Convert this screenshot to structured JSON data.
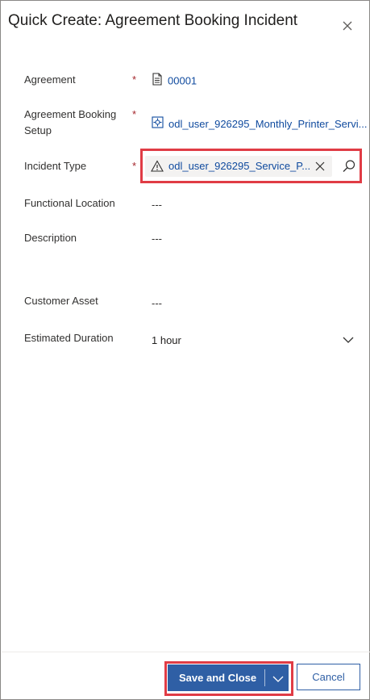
{
  "dialog": {
    "title": "Quick Create: Agreement Booking Incident"
  },
  "fields": {
    "agreement": {
      "label": "Agreement",
      "required": "*",
      "value": "00001"
    },
    "booking_setup": {
      "label_line1": "Agreement Booking",
      "label_line2": "Setup",
      "required": "*",
      "value": "odl_user_926295_Monthly_Printer_Servi..."
    },
    "incident_type": {
      "label": "Incident Type",
      "required": "*",
      "value": "odl_user_926295_Service_P..."
    },
    "functional_location": {
      "label": "Functional Location",
      "value": "---"
    },
    "description": {
      "label": "Description",
      "value": "---"
    },
    "customer_asset": {
      "label": "Customer Asset",
      "value": "---"
    },
    "estimated_duration": {
      "label": "Estimated Duration",
      "value": "1 hour"
    }
  },
  "footer": {
    "save_label": "Save and Close",
    "cancel_label": "Cancel"
  },
  "colors": {
    "accent": "#2f5fa5",
    "link": "#0f4a9e",
    "required": "#a4262c",
    "highlight": "#e03c45"
  },
  "icons": [
    "close-icon",
    "document-icon",
    "setup-icon",
    "warning-icon",
    "clear-icon",
    "search-icon",
    "chevron-down-icon"
  ]
}
